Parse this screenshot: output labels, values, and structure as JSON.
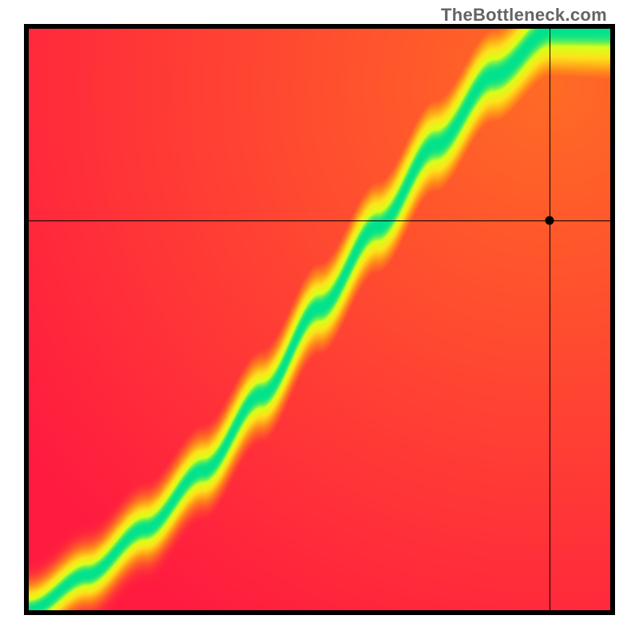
{
  "watermark": "TheBottleneck.com",
  "chart_data": {
    "type": "heatmap",
    "title": "",
    "xlabel": "",
    "ylabel": "",
    "description": "Bottleneck compatibility heatmap. Green diagonal ridge indicates balanced pairing; red regions indicate severe bottleneck. Crosshair marks a selected hardware combination.",
    "x_range": [
      0,
      1
    ],
    "y_range": [
      0,
      1
    ],
    "marker": {
      "x": 0.895,
      "y": 0.67
    },
    "ridge_points": [
      {
        "x": 0.0,
        "y": 0.0
      },
      {
        "x": 0.1,
        "y": 0.06
      },
      {
        "x": 0.2,
        "y": 0.14
      },
      {
        "x": 0.3,
        "y": 0.24
      },
      {
        "x": 0.4,
        "y": 0.37
      },
      {
        "x": 0.5,
        "y": 0.52
      },
      {
        "x": 0.6,
        "y": 0.66
      },
      {
        "x": 0.7,
        "y": 0.8
      },
      {
        "x": 0.8,
        "y": 0.92
      },
      {
        "x": 0.9,
        "y": 1.0
      }
    ],
    "color_scale": [
      {
        "stop": 0.0,
        "color": "#ff1a40"
      },
      {
        "stop": 0.45,
        "color": "#ff8c1a"
      },
      {
        "stop": 0.75,
        "color": "#ffe21a"
      },
      {
        "stop": 0.92,
        "color": "#d8ff1a"
      },
      {
        "stop": 1.0,
        "color": "#00e28c"
      }
    ],
    "render": {
      "base_width": 0.045,
      "width_growth": 0.035,
      "falloff": 2.6,
      "rim_boost": 0.32
    }
  }
}
